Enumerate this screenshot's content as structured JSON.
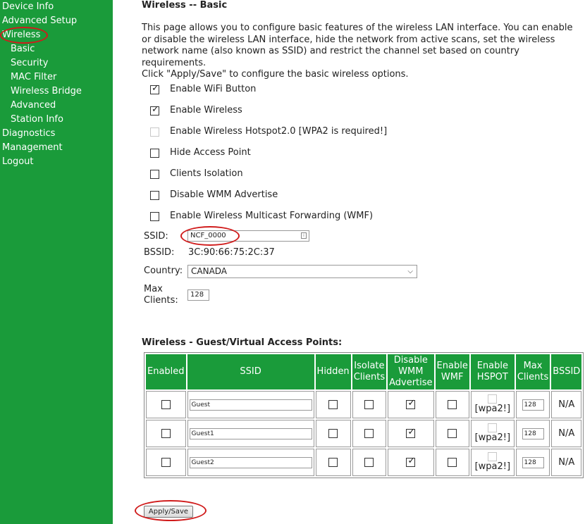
{
  "sidebar": {
    "items": [
      {
        "label": "Device Info"
      },
      {
        "label": "Advanced Setup"
      },
      {
        "label": "Wireless"
      },
      {
        "label": "Basic"
      },
      {
        "label": "Security"
      },
      {
        "label": "MAC Filter"
      },
      {
        "label": "Wireless Bridge"
      },
      {
        "label": "Advanced"
      },
      {
        "label": "Station Info"
      },
      {
        "label": "Diagnostics"
      },
      {
        "label": "Management"
      },
      {
        "label": "Logout"
      }
    ]
  },
  "page": {
    "title": "Wireless -- Basic",
    "intro": "This page allows you to configure basic features of the wireless LAN interface. You can enable or disable the wireless LAN interface, hide the network from active scans, set the wireless network name (also known as SSID) and restrict the channel set based on country requirements.",
    "intro2": "Click \"Apply/Save\" to configure the basic wireless options."
  },
  "options": [
    {
      "label": "Enable WiFi Button",
      "checked": true,
      "disabled": false
    },
    {
      "label": "Enable Wireless",
      "checked": true,
      "disabled": false
    },
    {
      "label": "Enable Wireless Hotspot2.0 [WPA2 is required!]",
      "checked": false,
      "disabled": true
    },
    {
      "label": "Hide Access Point",
      "checked": false,
      "disabled": false
    },
    {
      "label": "Clients Isolation",
      "checked": false,
      "disabled": false
    },
    {
      "label": "Disable WMM Advertise",
      "checked": false,
      "disabled": false
    },
    {
      "label": "Enable Wireless Multicast Forwarding (WMF)",
      "checked": false,
      "disabled": false
    }
  ],
  "form": {
    "ssid_label": "SSID:",
    "ssid_value": "NCF_0000",
    "bssid_label": "BSSID:",
    "bssid_value": "3C:90:66:75:2C:37",
    "country_label": "Country:",
    "country_value": "CANADA",
    "max_label_1": "Max",
    "max_label_2": "Clients:",
    "max_value": "128"
  },
  "guest": {
    "title": "Wireless - Guest/Virtual Access Points:",
    "headers": {
      "enabled": "Enabled",
      "ssid": "SSID",
      "hidden": "Hidden",
      "isolate_1": "Isolate",
      "isolate_2": "Clients",
      "wmm_1": "Disable",
      "wmm_2": "WMM",
      "wmm_3": "Advertise",
      "wmf_1": "Enable",
      "wmf_2": "WMF",
      "hspot_1": "Enable",
      "hspot_2": "HSPOT",
      "max_1": "Max",
      "max_2": "Clients",
      "bssid": "BSSID"
    },
    "rows": [
      {
        "ssid": "Guest",
        "max": "128",
        "hspot_note": "[wpa2!]",
        "bssid": "N/A"
      },
      {
        "ssid": "Guest1",
        "max": "128",
        "hspot_note": "[wpa2!]",
        "bssid": "N/A"
      },
      {
        "ssid": "Guest2",
        "max": "128",
        "hspot_note": "[wpa2!]",
        "bssid": "N/A"
      }
    ]
  },
  "apply_label": "Apply/Save",
  "colors": {
    "brand_green": "#1a9b3a",
    "annotation_red": "#d01c1c"
  }
}
